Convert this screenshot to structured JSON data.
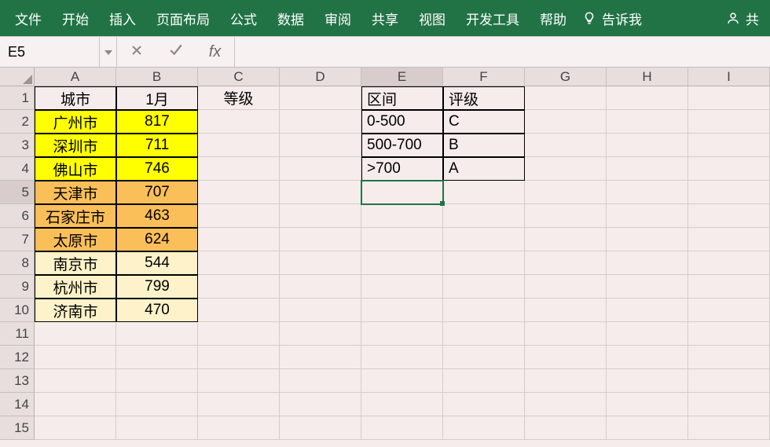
{
  "ribbon": {
    "tabs": [
      "文件",
      "开始",
      "插入",
      "页面布局",
      "公式",
      "数据",
      "审阅",
      "共享",
      "视图",
      "开发工具",
      "帮助"
    ],
    "tell_me": "告诉我",
    "share": "共"
  },
  "namebox": {
    "value": "E5"
  },
  "formula_bar": {
    "value": ""
  },
  "columns": [
    "A",
    "B",
    "C",
    "D",
    "E",
    "F",
    "G",
    "H",
    "I"
  ],
  "row_count": 15,
  "headers": {
    "A1": "城市",
    "B1": "1月",
    "C1": "等级",
    "E1": "区间",
    "F1": "评级"
  },
  "city_data": [
    {
      "city": "广州市",
      "val": "817",
      "fill": "yellow"
    },
    {
      "city": "深圳市",
      "val": "711",
      "fill": "yellow"
    },
    {
      "city": "佛山市",
      "val": "746",
      "fill": "yellow"
    },
    {
      "city": "天津市",
      "val": "707",
      "fill": "orange"
    },
    {
      "city": "石家庄市",
      "val": "463",
      "fill": "orange"
    },
    {
      "city": "太原市",
      "val": "624",
      "fill": "orange"
    },
    {
      "city": "南京市",
      "val": "544",
      "fill": "cream"
    },
    {
      "city": "杭州市",
      "val": "799",
      "fill": "cream"
    },
    {
      "city": "济南市",
      "val": "470",
      "fill": "cream"
    }
  ],
  "lookup": [
    {
      "range": "0-500",
      "grade": "C"
    },
    {
      "range": "500-700",
      "grade": "B"
    },
    {
      "range": ">700",
      "grade": "A"
    }
  ],
  "active_cell": "E5",
  "colors": {
    "ribbon": "#217346"
  }
}
